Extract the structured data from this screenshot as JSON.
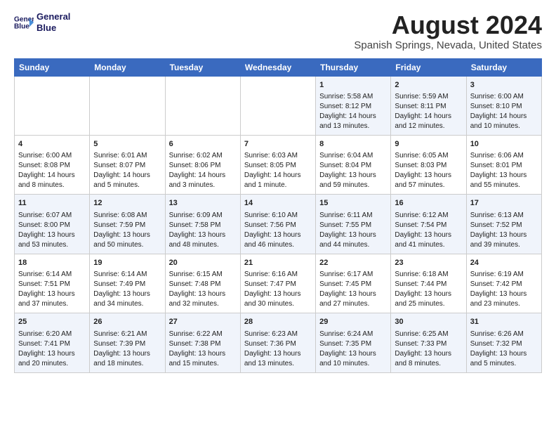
{
  "header": {
    "logo_line1": "General",
    "logo_line2": "Blue",
    "month_title": "August 2024",
    "location": "Spanish Springs, Nevada, United States"
  },
  "days_of_week": [
    "Sunday",
    "Monday",
    "Tuesday",
    "Wednesday",
    "Thursday",
    "Friday",
    "Saturday"
  ],
  "weeks": [
    [
      {
        "day": "",
        "text": ""
      },
      {
        "day": "",
        "text": ""
      },
      {
        "day": "",
        "text": ""
      },
      {
        "day": "",
        "text": ""
      },
      {
        "day": "1",
        "text": "Sunrise: 5:58 AM\nSunset: 8:12 PM\nDaylight: 14 hours\nand 13 minutes."
      },
      {
        "day": "2",
        "text": "Sunrise: 5:59 AM\nSunset: 8:11 PM\nDaylight: 14 hours\nand 12 minutes."
      },
      {
        "day": "3",
        "text": "Sunrise: 6:00 AM\nSunset: 8:10 PM\nDaylight: 14 hours\nand 10 minutes."
      }
    ],
    [
      {
        "day": "4",
        "text": "Sunrise: 6:00 AM\nSunset: 8:08 PM\nDaylight: 14 hours\nand 8 minutes."
      },
      {
        "day": "5",
        "text": "Sunrise: 6:01 AM\nSunset: 8:07 PM\nDaylight: 14 hours\nand 5 minutes."
      },
      {
        "day": "6",
        "text": "Sunrise: 6:02 AM\nSunset: 8:06 PM\nDaylight: 14 hours\nand 3 minutes."
      },
      {
        "day": "7",
        "text": "Sunrise: 6:03 AM\nSunset: 8:05 PM\nDaylight: 14 hours\nand 1 minute."
      },
      {
        "day": "8",
        "text": "Sunrise: 6:04 AM\nSunset: 8:04 PM\nDaylight: 13 hours\nand 59 minutes."
      },
      {
        "day": "9",
        "text": "Sunrise: 6:05 AM\nSunset: 8:03 PM\nDaylight: 13 hours\nand 57 minutes."
      },
      {
        "day": "10",
        "text": "Sunrise: 6:06 AM\nSunset: 8:01 PM\nDaylight: 13 hours\nand 55 minutes."
      }
    ],
    [
      {
        "day": "11",
        "text": "Sunrise: 6:07 AM\nSunset: 8:00 PM\nDaylight: 13 hours\nand 53 minutes."
      },
      {
        "day": "12",
        "text": "Sunrise: 6:08 AM\nSunset: 7:59 PM\nDaylight: 13 hours\nand 50 minutes."
      },
      {
        "day": "13",
        "text": "Sunrise: 6:09 AM\nSunset: 7:58 PM\nDaylight: 13 hours\nand 48 minutes."
      },
      {
        "day": "14",
        "text": "Sunrise: 6:10 AM\nSunset: 7:56 PM\nDaylight: 13 hours\nand 46 minutes."
      },
      {
        "day": "15",
        "text": "Sunrise: 6:11 AM\nSunset: 7:55 PM\nDaylight: 13 hours\nand 44 minutes."
      },
      {
        "day": "16",
        "text": "Sunrise: 6:12 AM\nSunset: 7:54 PM\nDaylight: 13 hours\nand 41 minutes."
      },
      {
        "day": "17",
        "text": "Sunrise: 6:13 AM\nSunset: 7:52 PM\nDaylight: 13 hours\nand 39 minutes."
      }
    ],
    [
      {
        "day": "18",
        "text": "Sunrise: 6:14 AM\nSunset: 7:51 PM\nDaylight: 13 hours\nand 37 minutes."
      },
      {
        "day": "19",
        "text": "Sunrise: 6:14 AM\nSunset: 7:49 PM\nDaylight: 13 hours\nand 34 minutes."
      },
      {
        "day": "20",
        "text": "Sunrise: 6:15 AM\nSunset: 7:48 PM\nDaylight: 13 hours\nand 32 minutes."
      },
      {
        "day": "21",
        "text": "Sunrise: 6:16 AM\nSunset: 7:47 PM\nDaylight: 13 hours\nand 30 minutes."
      },
      {
        "day": "22",
        "text": "Sunrise: 6:17 AM\nSunset: 7:45 PM\nDaylight: 13 hours\nand 27 minutes."
      },
      {
        "day": "23",
        "text": "Sunrise: 6:18 AM\nSunset: 7:44 PM\nDaylight: 13 hours\nand 25 minutes."
      },
      {
        "day": "24",
        "text": "Sunrise: 6:19 AM\nSunset: 7:42 PM\nDaylight: 13 hours\nand 23 minutes."
      }
    ],
    [
      {
        "day": "25",
        "text": "Sunrise: 6:20 AM\nSunset: 7:41 PM\nDaylight: 13 hours\nand 20 minutes."
      },
      {
        "day": "26",
        "text": "Sunrise: 6:21 AM\nSunset: 7:39 PM\nDaylight: 13 hours\nand 18 minutes."
      },
      {
        "day": "27",
        "text": "Sunrise: 6:22 AM\nSunset: 7:38 PM\nDaylight: 13 hours\nand 15 minutes."
      },
      {
        "day": "28",
        "text": "Sunrise: 6:23 AM\nSunset: 7:36 PM\nDaylight: 13 hours\nand 13 minutes."
      },
      {
        "day": "29",
        "text": "Sunrise: 6:24 AM\nSunset: 7:35 PM\nDaylight: 13 hours\nand 10 minutes."
      },
      {
        "day": "30",
        "text": "Sunrise: 6:25 AM\nSunset: 7:33 PM\nDaylight: 13 hours\nand 8 minutes."
      },
      {
        "day": "31",
        "text": "Sunrise: 6:26 AM\nSunset: 7:32 PM\nDaylight: 13 hours\nand 5 minutes."
      }
    ]
  ]
}
